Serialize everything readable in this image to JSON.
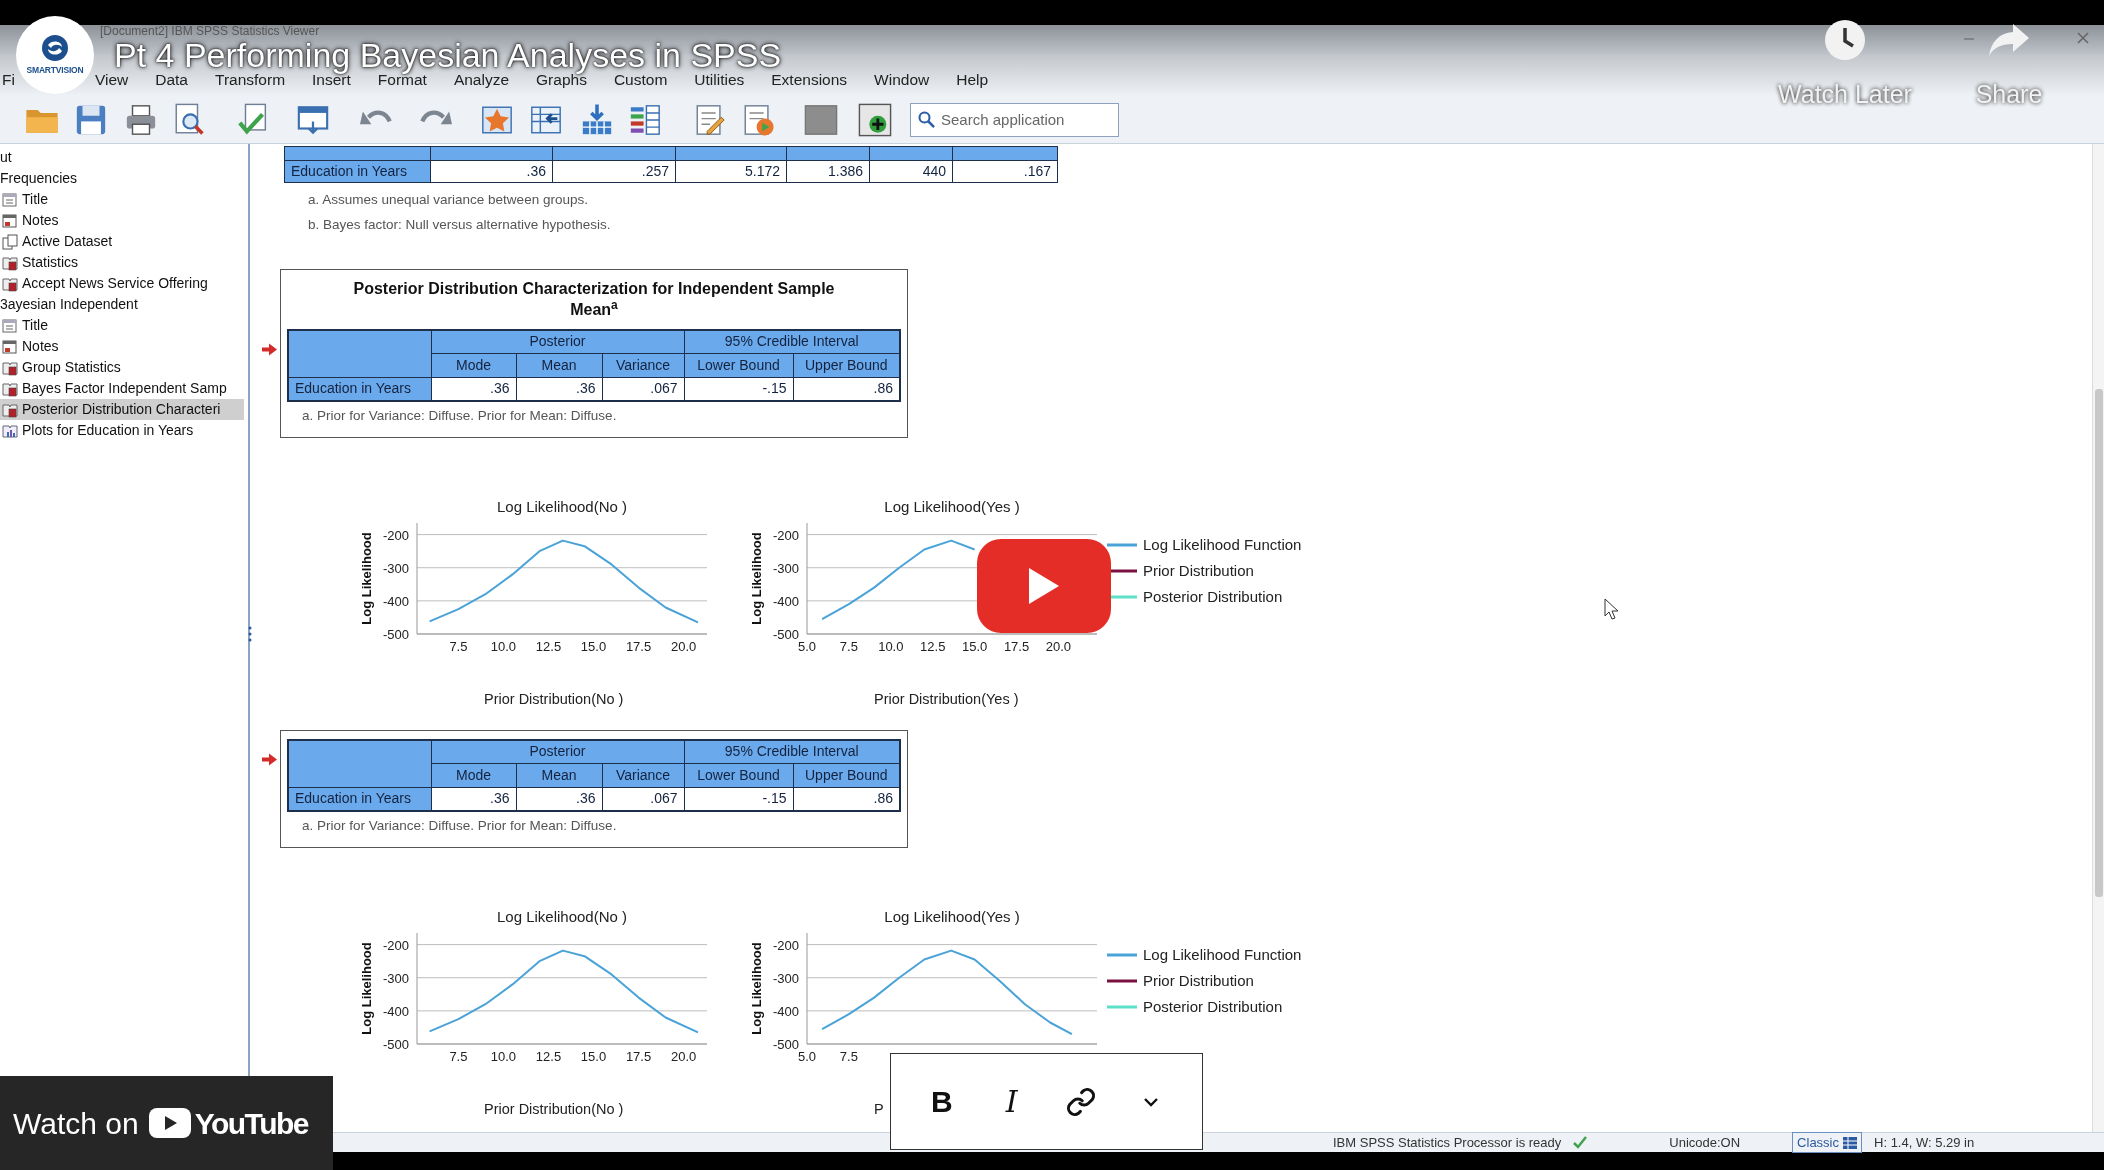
{
  "video": {
    "title": "Pt 4 Performing Bayesian Analyses in SPSS",
    "channel_logo_text": "SMARTVISION",
    "actions": [
      {
        "kind": "watch_later",
        "label": "Watch Later"
      },
      {
        "kind": "share",
        "label": "Share"
      }
    ],
    "watch_on": {
      "text": "Watch on",
      "brand": "YouTube"
    }
  },
  "window": {
    "title": "[Document2]  IBM SPSS Statistics Viewer"
  },
  "menu": [
    "Fi",
    "View",
    "Data",
    "Transform",
    "Insert",
    "Format",
    "Analyze",
    "Graphs",
    "Custom",
    "Utilities",
    "Extensions",
    "Window",
    "Help"
  ],
  "search": {
    "placeholder": "Search application"
  },
  "tree": [
    {
      "label": "ut",
      "selected": false
    },
    {
      "label": "Frequencies",
      "selected": false,
      "children": [
        {
          "label": "Title",
          "kind": "title",
          "selected": false
        },
        {
          "label": "Notes",
          "kind": "notes",
          "selected": false
        },
        {
          "label": "Active Dataset",
          "kind": "dataset",
          "selected": false
        },
        {
          "label": "Statistics",
          "kind": "table",
          "selected": false
        },
        {
          "label": "Accept News Service Offering",
          "kind": "table",
          "selected": false
        }
      ]
    },
    {
      "label": "3ayesian Independent",
      "selected": false,
      "children": [
        {
          "label": "Title",
          "kind": "title",
          "selected": false
        },
        {
          "label": "Notes",
          "kind": "notes",
          "selected": false
        },
        {
          "label": "Group Statistics",
          "kind": "table",
          "selected": false
        },
        {
          "label": "Bayes Factor Independent Samp",
          "kind": "table",
          "selected": false
        },
        {
          "label": "Posterior Distribution Characteri",
          "kind": "table",
          "selected": true
        },
        {
          "label": "Plots for Education in Years",
          "kind": "chart",
          "selected": false
        }
      ]
    }
  ],
  "output": [
    {
      "kind": "bayes_factor_table",
      "row": {
        "label": "Education in Years",
        "cells": [
          ".36",
          ".257",
          "5.172",
          "1.386",
          "440",
          ".167"
        ]
      },
      "footnotes": [
        "a. Assumes unequal variance between groups.",
        "b. Bayes factor: Null versus alternative hypothesis."
      ]
    },
    {
      "kind": "posterior_table",
      "title": "Posterior Distribution Characterization for Independent Sample Mean$^{a}$",
      "group_headers": [
        "Posterior",
        "95% Credible Interval"
      ],
      "columns": [
        "Mode",
        "Mean",
        "Variance",
        "Lower Bound",
        "Upper Bound"
      ],
      "row": {
        "label": "Education in Years",
        "cells": [
          ".36",
          ".36",
          ".067",
          "-.15",
          ".86"
        ]
      },
      "footnote": "a. Prior for Variance: Diffuse. Prior for Mean: Diffuse."
    },
    {
      "kind": "plots",
      "charts": [
        {
          "chart_data": {
            "type": "line",
            "title": "Log Likelihood(No )",
            "ylabel": "Log Likelihood",
            "x": [
              5.9,
              7.5,
              9,
              10.5,
              12,
              13.3,
              14.5,
              16,
              17.5,
              19,
              20.8
            ],
            "series": [
              {
                "color": "#4aa3d8",
                "values": [
                  -462,
                  -425,
                  -380,
                  -320,
                  -250,
                  -218,
                  -235,
                  -290,
                  -360,
                  -420,
                  -465
                ]
              }
            ],
            "xlim": [
              5.2,
              21.3
            ],
            "ylim": [
              -500,
              -165
            ],
            "grid": true,
            "xticks": [
              {
                "value": 7.5,
                "label": "7.5"
              },
              {
                "value": 10,
                "label": "10.0"
              },
              {
                "value": 12.5,
                "label": "12.5"
              },
              {
                "value": 15,
                "label": "15.0"
              },
              {
                "value": 17.5,
                "label": "17.5"
              },
              {
                "value": 20,
                "label": "20.0"
              }
            ],
            "yticks": [
              -200,
              -300,
              -400,
              -500
            ]
          }
        },
        {
          "chart_data": {
            "type": "line",
            "title": "Log Likelihood(Yes )",
            "ylabel": "Log Likelihood",
            "x": [
              5.9,
              7.5,
              9,
              10.5,
              12,
              13.6,
              15
            ],
            "series": [
              {
                "color": "#4aa3d8",
                "values": [
                  -455,
                  -410,
                  -360,
                  -300,
                  -245,
                  -218,
                  -245
                ]
              }
            ],
            "xlim": [
              5,
              22.3
            ],
            "ylim": [
              -500,
              -165
            ],
            "grid": true,
            "xticks": [
              {
                "value": 5,
                "label": "5.0"
              },
              {
                "value": 7.5,
                "label": "7.5"
              },
              {
                "value": 10,
                "label": "10.0"
              },
              {
                "value": 12.5,
                "label": "12.5"
              },
              {
                "value": 15,
                "label": "15.0"
              },
              {
                "value": 17.5,
                "label": "17.5"
              },
              {
                "value": 20,
                "label": "20.0"
              }
            ],
            "yticks": [
              -200,
              -300,
              -400,
              -500
            ]
          }
        }
      ],
      "legend": [
        {
          "label": "Log Likelihood Function",
          "color": "#4aa3d8"
        },
        {
          "label": "Prior Distribution",
          "color": "#7b1040"
        },
        {
          "label": "Posterior Distribution",
          "color": "#5ee0c8"
        }
      ],
      "captions": [
        "Prior Distribution(No )",
        "Prior Distribution(Yes )"
      ]
    },
    {
      "kind": "posterior_table",
      "group_headers": [
        "Posterior",
        "95% Credible Interval"
      ],
      "columns": [
        "Mode",
        "Mean",
        "Variance",
        "Lower Bound",
        "Upper Bound"
      ],
      "row": {
        "label": "Education in Years",
        "cells": [
          ".36",
          ".36",
          ".067",
          "-.15",
          ".86"
        ]
      },
      "footnote": "a. Prior for Variance: Diffuse. Prior for Mean: Diffuse."
    },
    {
      "kind": "plots",
      "charts": [
        {
          "chart_data": {
            "type": "line",
            "title": "Log Likelihood(No )",
            "ylabel": "Log Likelihood",
            "x": [
              5.9,
              7.5,
              9,
              10.5,
              12,
              13.3,
              14.5,
              16,
              17.5,
              19,
              20.8
            ],
            "series": [
              {
                "color": "#4aa3d8",
                "values": [
                  -462,
                  -425,
                  -380,
                  -320,
                  -250,
                  -218,
                  -235,
                  -290,
                  -360,
                  -420,
                  -465
                ]
              }
            ],
            "xlim": [
              5.2,
              21.3
            ],
            "ylim": [
              -500,
              -165
            ],
            "grid": true,
            "xticks": [
              {
                "value": 7.5,
                "label": "7.5"
              },
              {
                "value": 10,
                "label": "10.0"
              },
              {
                "value": 12.5,
                "label": "12.5"
              },
              {
                "value": 15,
                "label": "15.0"
              },
              {
                "value": 17.5,
                "label": "17.5"
              },
              {
                "value": 20,
                "label": "20.0"
              }
            ],
            "yticks": [
              -200,
              -300,
              -400,
              -500
            ]
          }
        },
        {
          "chart_data": {
            "type": "line",
            "title": "Log Likelihood(Yes )",
            "ylabel": "Log Likelihood",
            "x": [
              5.9,
              7.5,
              9,
              10.5,
              12,
              13.6,
              15,
              16.5,
              18,
              19.5,
              20.8
            ],
            "series": [
              {
                "color": "#4aa3d8",
                "values": [
                  -455,
                  -410,
                  -360,
                  -300,
                  -245,
                  -218,
                  -245,
                  -310,
                  -380,
                  -435,
                  -470
                ]
              }
            ],
            "xlim": [
              5,
              22.3
            ],
            "ylim": [
              -500,
              -165
            ],
            "grid": true,
            "xticks": [
              {
                "value": 5,
                "label": "5.0"
              },
              {
                "value": 7.5,
                "label": "7.5"
              }
            ],
            "yticks": [
              -200,
              -300,
              -400,
              -500
            ]
          }
        }
      ],
      "legend": [
        {
          "label": "Log Likelihood Function",
          "color": "#4aa3d8"
        },
        {
          "label": "Prior Distribution",
          "color": "#7b1040"
        },
        {
          "label": "Posterior Distribution",
          "color": "#5ee0c8"
        }
      ],
      "captions": [
        "Prior Distribution(No )",
        "P"
      ]
    }
  ],
  "format_toolbar": {
    "bold": "B",
    "italic": "I"
  },
  "status_bar": {
    "message": "IBM SPSS Statistics Processor is ready",
    "encoding": "Unicode:ON",
    "mode": "Classic",
    "size": "H: 1.4, W: 5.29 in"
  }
}
